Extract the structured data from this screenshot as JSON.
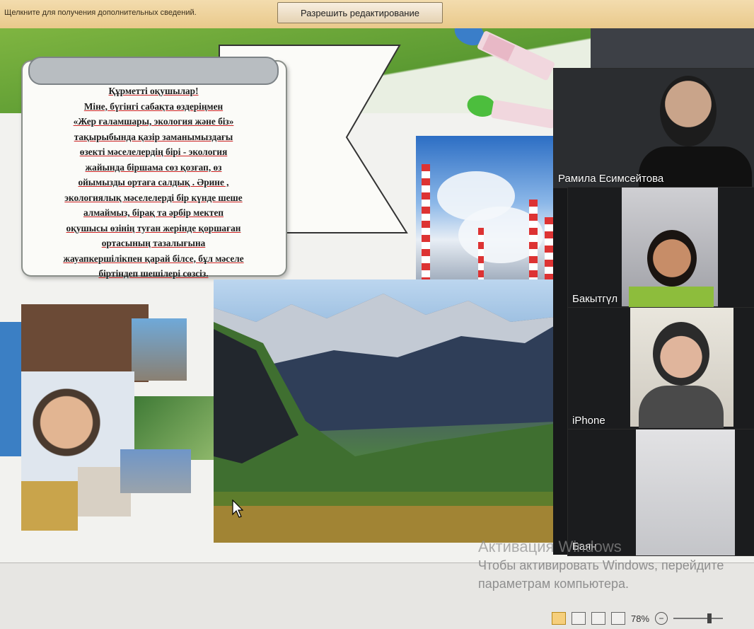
{
  "infobar": {
    "message": "Щелкните для получения дополнительных сведений.",
    "enable_editing_label": "Разрешить редактирование"
  },
  "slide": {
    "scroll_lines": [
      "Құрметті оқушылар!",
      "Міне, бүгінгі сабақта өздеріңмен",
      "«Жер ғаламшары, экология және біз»",
      "тақырыбында қазір заманымыздағы",
      "өзекті мәселелердің бірі - экология",
      "жайында біршама сөз қозғап, өз",
      "ойымызды ортаға салдық . Әрине ,",
      "экологиялық мәселелерді бір күнде шеше",
      "алмаймыз, бірақ та әрбір мектеп",
      "оқушысы өзінің туған жерінде қоршаған",
      "ортасының тазалығына",
      "жауапкершілікпен қарай білсе, бұл мәселе",
      "біртіндеп шешілері сөзсіз."
    ],
    "colors": {
      "green": "#6aa53a",
      "scroll_border": "#8a8f8a",
      "underline": "#cc2222"
    }
  },
  "video_panel": {
    "participants": [
      {
        "name": "Рамила Есимсейтова"
      },
      {
        "name": "Бакытгүл"
      },
      {
        "name": "iPhone"
      },
      {
        "name": "Баян"
      }
    ]
  },
  "watermark": {
    "title": "Активация Windows",
    "line1": "Чтобы активировать Windows, перейдите",
    "line2": "параметрам компьютера."
  },
  "statusbar": {
    "zoom_level": "78%",
    "zoom_minus": "−"
  }
}
